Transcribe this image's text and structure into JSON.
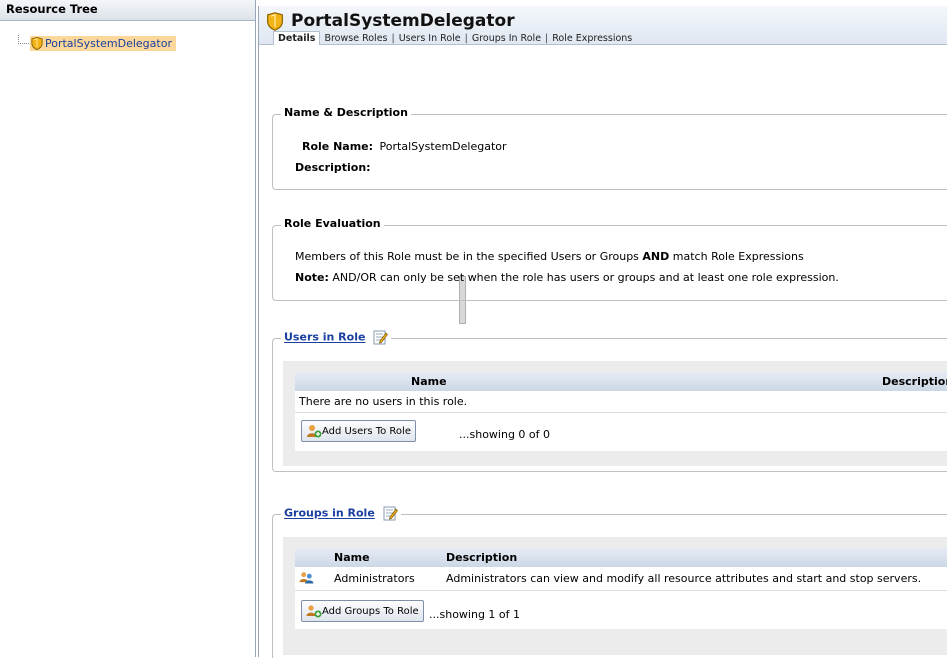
{
  "left_panel": {
    "title": "Resource Tree",
    "tree_item": "PortalSystemDelegator"
  },
  "header": {
    "title": "PortalSystemDelegator"
  },
  "tabs": [
    "Details",
    "Browse Roles",
    "Users In Role",
    "Groups In Role",
    "Role Expressions"
  ],
  "name_desc": {
    "legend": "Name & Description",
    "role_name_label": "Role Name:",
    "role_name_value": "PortalSystemDelegator",
    "description_label": "Description:"
  },
  "role_eval": {
    "legend": "Role Evaluation",
    "line1_prefix": "Members of this Role must be in the specified Users or Groups ",
    "line1_bold": "AND",
    "line1_suffix": " match Role Expressions",
    "note_label": "Note:",
    "note_text": " AND/OR can only be set when the role has users or groups and at least one role expression."
  },
  "users": {
    "legend": "Users in Role",
    "col_name": "Name",
    "col_desc": "Description",
    "empty": "There are no users in this role.",
    "add_button": "Add Users To Role",
    "showing": "...showing 0 of 0"
  },
  "groups": {
    "legend": "Groups in Role",
    "col_name": "Name",
    "col_desc": "Description",
    "rows": [
      {
        "name": "Administrators",
        "description": "Administrators can view and modify all resource attributes and start and stop servers."
      }
    ],
    "add_button": "Add Groups To Role",
    "showing": "...showing 1 of 1"
  },
  "colors": {
    "tree_highlight": "#fbd79a",
    "link": "#1a3fa0",
    "shield": "#f2b315"
  }
}
